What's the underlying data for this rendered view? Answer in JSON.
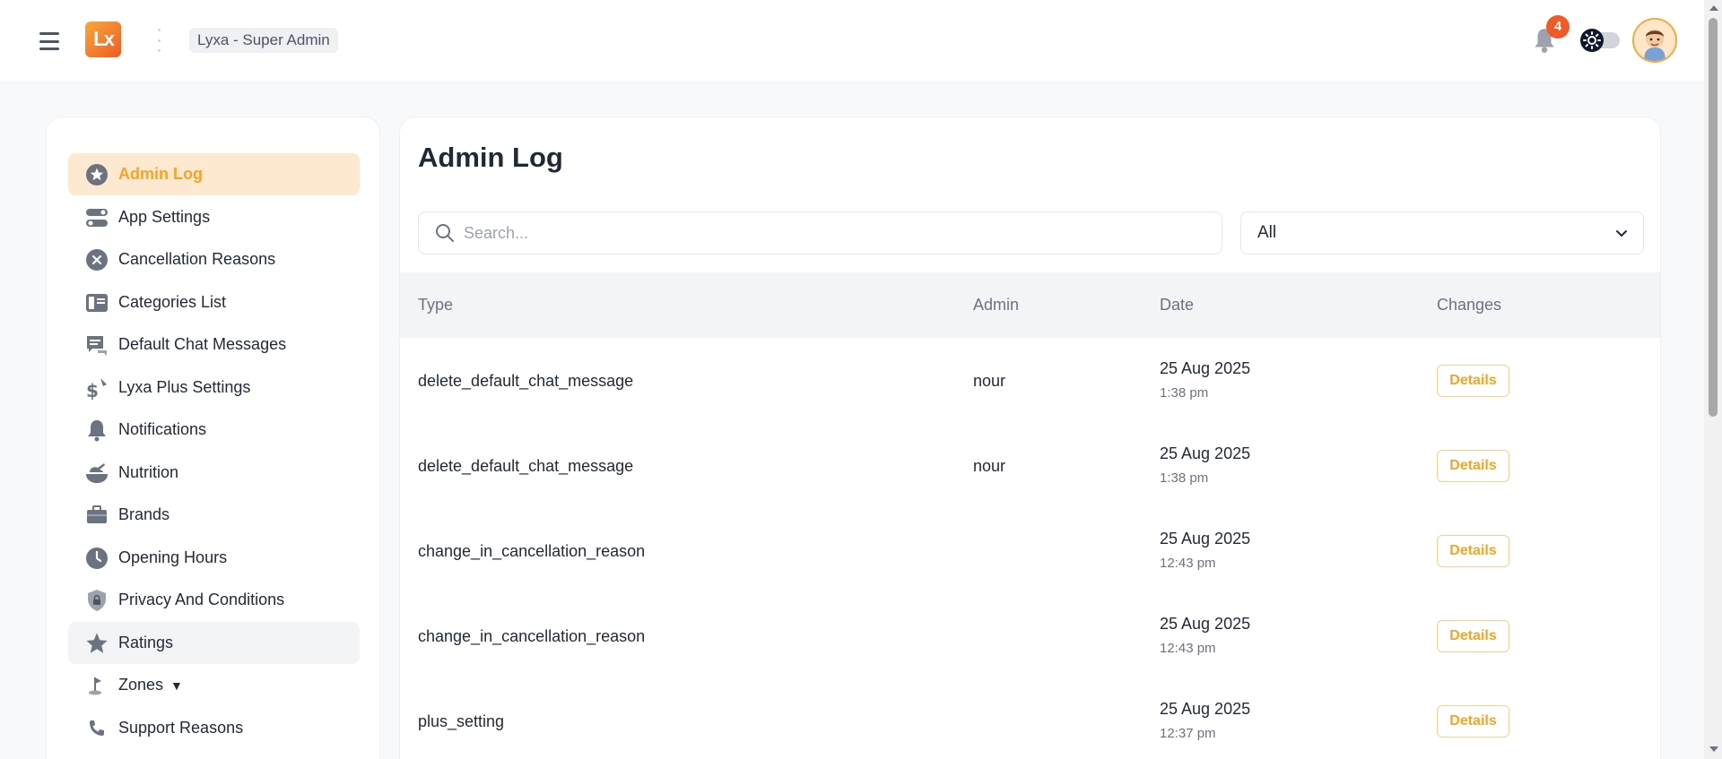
{
  "header": {
    "logo_text": "Lx",
    "tenant": "Lyxa - Super Admin",
    "notification_count": "4"
  },
  "sidebar": {
    "items": [
      {
        "label": "Admin Log",
        "icon": "star-circle-icon",
        "active": true
      },
      {
        "label": "App Settings",
        "icon": "toggles-icon"
      },
      {
        "label": "Cancellation Reasons",
        "icon": "x-circle-icon"
      },
      {
        "label": "Categories List",
        "icon": "categories-icon"
      },
      {
        "label": "Default Chat Messages",
        "icon": "chat-icon"
      },
      {
        "label": "Lyxa Plus Settings",
        "icon": "dollar-icon"
      },
      {
        "label": "Notifications",
        "icon": "bell-icon"
      },
      {
        "label": "Nutrition",
        "icon": "nutrition-icon"
      },
      {
        "label": "Brands",
        "icon": "briefcase-icon"
      },
      {
        "label": "Opening Hours",
        "icon": "clock-icon"
      },
      {
        "label": "Privacy And Conditions",
        "icon": "shield-lock-icon"
      },
      {
        "label": "Ratings",
        "icon": "star-icon",
        "hover": true
      },
      {
        "label": "Zones",
        "icon": "flag-icon",
        "caret": "▼"
      },
      {
        "label": "Support Reasons",
        "icon": "phone-icon"
      }
    ]
  },
  "main": {
    "title": "Admin Log",
    "search_placeholder": "Search...",
    "filter_value": "All",
    "columns": {
      "type": "Type",
      "admin": "Admin",
      "date": "Date",
      "changes": "Changes"
    },
    "details_label": "Details",
    "rows": [
      {
        "type": "delete_default_chat_message",
        "admin": "nour",
        "date": "25 Aug 2025",
        "time": "1:38 pm"
      },
      {
        "type": "delete_default_chat_message",
        "admin": "nour",
        "date": "25 Aug 2025",
        "time": "1:38 pm"
      },
      {
        "type": "change_in_cancellation_reason",
        "admin": "",
        "date": "25 Aug 2025",
        "time": "12:43 pm"
      },
      {
        "type": "change_in_cancellation_reason",
        "admin": "",
        "date": "25 Aug 2025",
        "time": "12:43 pm"
      },
      {
        "type": "plus_setting",
        "admin": "",
        "date": "25 Aug 2025",
        "time": "12:37 pm"
      }
    ]
  },
  "colors": {
    "accent": "#f5a524",
    "accent_bg": "#fde9d0",
    "badge": "#f15a24",
    "icon_gray": "#6b7280"
  }
}
